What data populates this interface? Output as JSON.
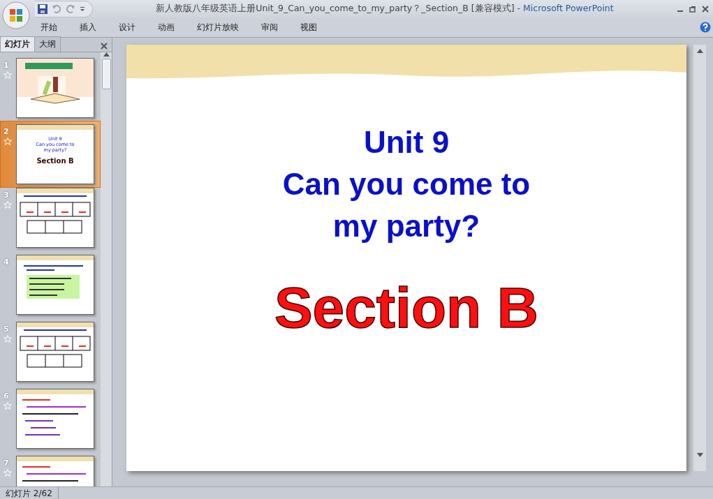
{
  "window": {
    "title_document": "新人教版八年级英语上册Unit_9_Can_you_come_to_my_party？_Section_B  [兼容模式]",
    "title_separator": "-",
    "title_app": "Microsoft PowerPoint"
  },
  "ribbon_tabs": [
    "开始",
    "插入",
    "设计",
    "动画",
    "幻灯片放映",
    "审阅",
    "视图"
  ],
  "panel_tabs": [
    {
      "label": "幻灯片",
      "selected": true
    },
    {
      "label": "大纲",
      "selected": false
    }
  ],
  "slides": [
    {
      "number": "1",
      "animated": true,
      "selected": false,
      "kind": "cover"
    },
    {
      "number": "2",
      "animated": true,
      "selected": true,
      "kind": "title",
      "lines": [
        "Unit 9",
        "Can you come to",
        "my party?"
      ],
      "heading": "Section B"
    },
    {
      "number": "3",
      "animated": true,
      "selected": false,
      "kind": "table"
    },
    {
      "number": "4",
      "animated": false,
      "selected": false,
      "kind": "list"
    },
    {
      "number": "5",
      "animated": true,
      "selected": false,
      "kind": "table"
    },
    {
      "number": "6",
      "animated": true,
      "selected": false,
      "kind": "text"
    },
    {
      "number": "7",
      "animated": true,
      "selected": false,
      "kind": "text"
    }
  ],
  "current_slide": {
    "title_lines": [
      "Unit 9",
      "Can you come to",
      "my party?"
    ],
    "subtitle": "Section B"
  },
  "status_bar": {
    "slide_counter": "幻灯片 2/62"
  }
}
